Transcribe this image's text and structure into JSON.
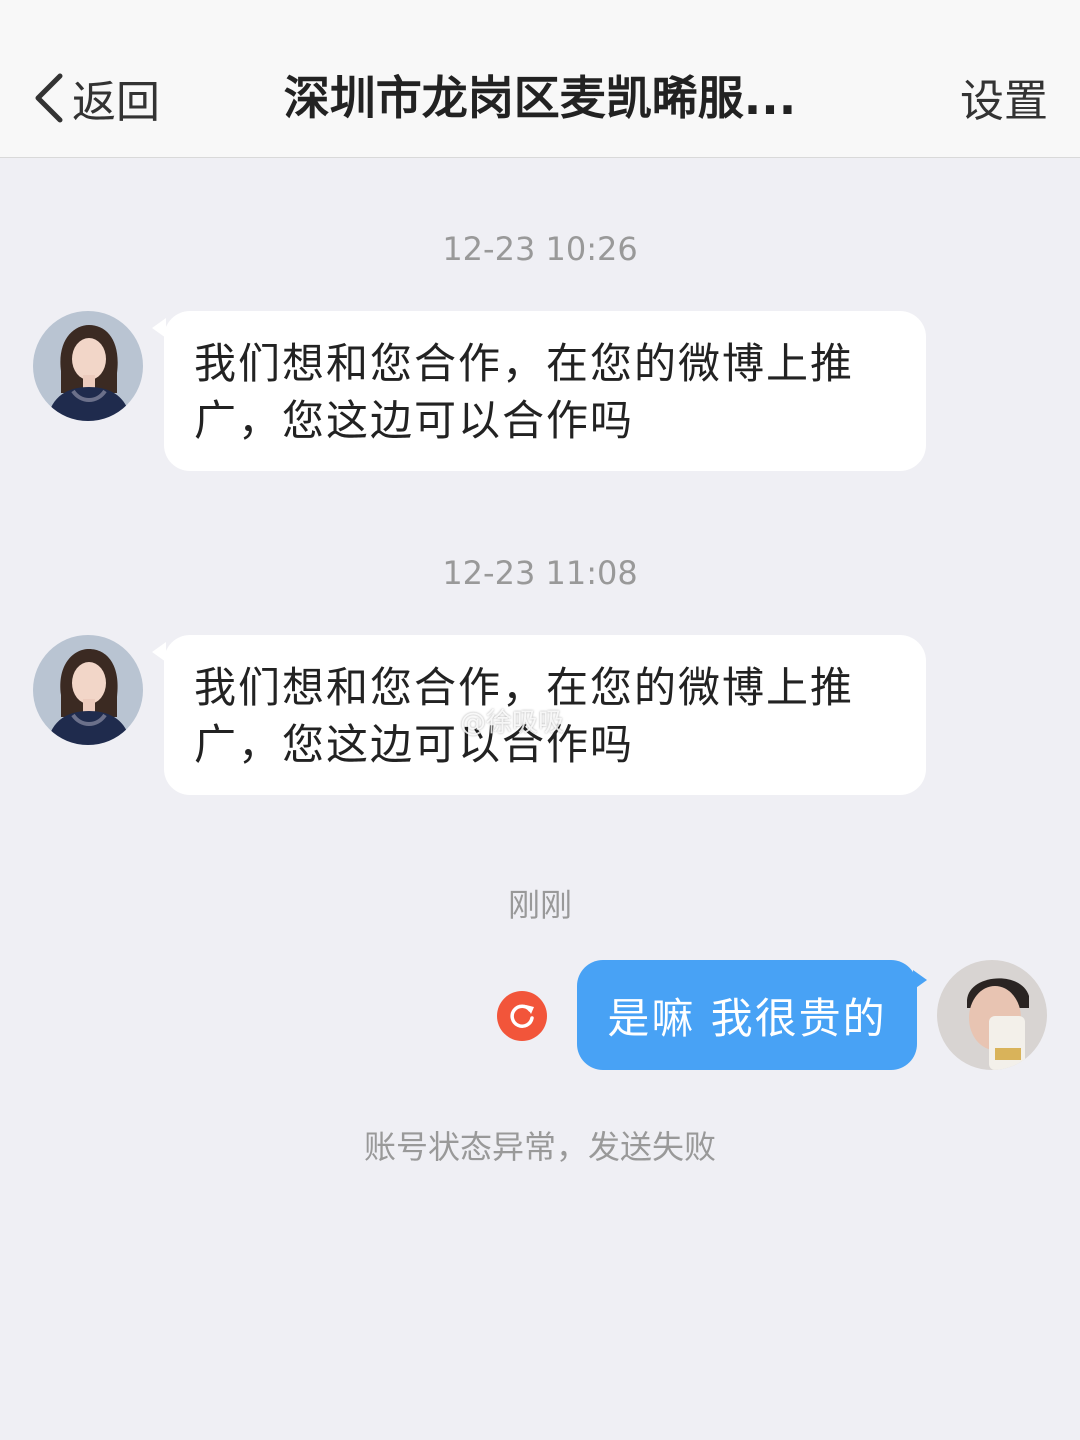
{
  "nav": {
    "back_label": "返回",
    "title": "深圳市龙岗区麦凯晞服...",
    "settings_label": "设置"
  },
  "messages": [
    {
      "time": "12-23 10:26",
      "text": "我们想和您合作，在您的微博上推广，您这边可以合作吗"
    },
    {
      "time": "12-23 11:08",
      "text": "我们想和您合作，在您的微博上推广，您这边可以合作吗"
    }
  ],
  "outgoing": {
    "time": "刚刚",
    "text": "是嘛 我很贵的",
    "status": "账号状态异常，发送失败"
  },
  "watermark": "@徐吸吸",
  "colors": {
    "background": "#efeff4",
    "bubble_out": "#48a2f5",
    "resend": "#f2553a"
  }
}
